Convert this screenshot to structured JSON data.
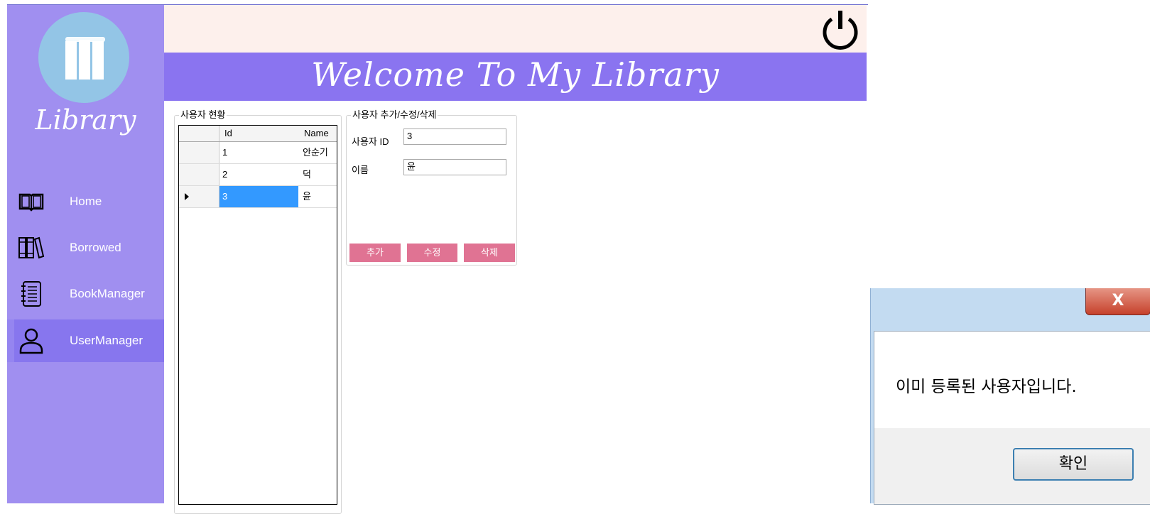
{
  "app": {
    "logo_text": "Library",
    "banner_title": "Welcome To My Library"
  },
  "sidebar": {
    "items": [
      {
        "label": "Home",
        "icon": "open-book-icon"
      },
      {
        "label": "Borrowed",
        "icon": "books-icon"
      },
      {
        "label": "BookManager",
        "icon": "notebook-icon"
      },
      {
        "label": "UserManager",
        "icon": "user-icon",
        "active": true
      }
    ]
  },
  "user_list": {
    "title": "사용자 현황",
    "columns": [
      "Id",
      "Name"
    ],
    "rows": [
      {
        "id": "1",
        "name": "안순기"
      },
      {
        "id": "2",
        "name": "덕"
      },
      {
        "id": "3",
        "name": "윤",
        "selected": true
      }
    ]
  },
  "user_form": {
    "title": "사용자 추가/수정/삭제",
    "id_label": "사용자 ID",
    "id_value": "3",
    "name_label": "이름",
    "name_value": "윤",
    "add_label": "추가",
    "edit_label": "수정",
    "delete_label": "삭제"
  },
  "dialog": {
    "close_label": "X",
    "message": "이미 등록된 사용자입니다.",
    "ok_label": "확인"
  },
  "colors": {
    "sidebar": "#a08ff0",
    "banner": "#8a74f0",
    "button": "#e07393",
    "selection": "#3399ff"
  }
}
